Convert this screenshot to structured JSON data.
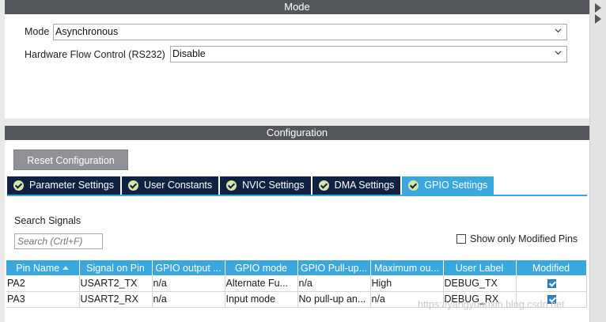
{
  "mode_panel": {
    "header": "Mode",
    "mode_label": "Mode",
    "mode_value": "Asynchronous",
    "flow_label": "Hardware Flow Control (RS232)",
    "flow_value": "Disable"
  },
  "config_panel": {
    "header": "Configuration",
    "reset_button": "Reset Configuration",
    "tabs": [
      {
        "label": "Parameter Settings",
        "active": false
      },
      {
        "label": "User Constants",
        "active": false
      },
      {
        "label": "NVIC Settings",
        "active": false
      },
      {
        "label": "DMA Settings",
        "active": false
      },
      {
        "label": "GPIO Settings",
        "active": true
      }
    ],
    "search_label": "Search Signals",
    "search_placeholder": "Search (Crtl+F)",
    "show_modified_label": "Show only Modified Pins",
    "table": {
      "headers": [
        "Pin Name",
        "Signal on Pin",
        "GPIO output ...",
        "GPIO mode",
        "GPIO Pull-up...",
        "Maximum ou...",
        "User Label",
        "Modified"
      ],
      "rows": [
        [
          "PA2",
          "USART2_TX",
          "n/a",
          "Alternate Fu...",
          "n/a",
          "High",
          "DEBUG_TX",
          "checked"
        ],
        [
          "PA3",
          "USART2_RX",
          "n/a",
          "Input mode",
          "No pull-up an...",
          "n/a",
          "DEBUG_RX",
          "checked"
        ]
      ]
    }
  },
  "watermark": "https://yangyuanxin.blog.csdn.net",
  "colors": {
    "header_bg": "#53565a",
    "tab_bg": "#0f2244",
    "tab_active": "#3aa7de",
    "table_header": "#3aa7de"
  }
}
